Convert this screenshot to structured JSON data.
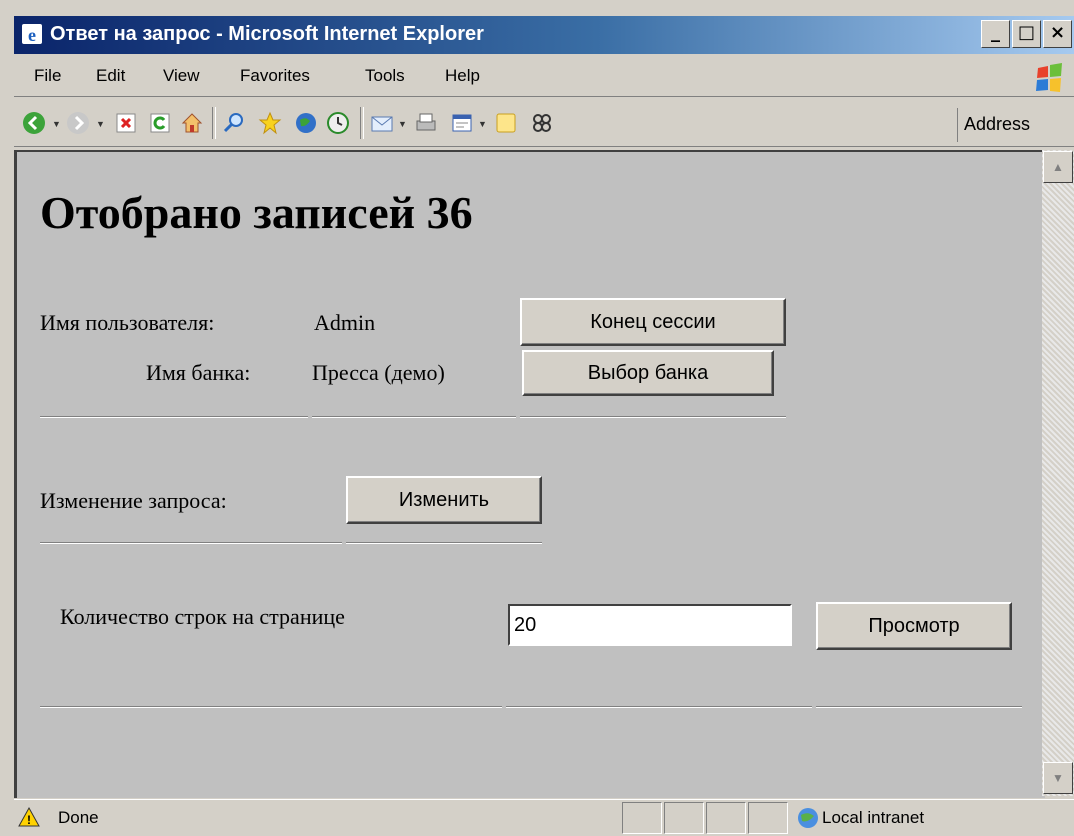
{
  "window": {
    "title": "Ответ на запрос - Microsoft Internet Explorer",
    "controls": [
      "_",
      "□",
      "×"
    ]
  },
  "menu": [
    "File",
    "Edit",
    "View",
    "Favorites",
    "Tools",
    "Help"
  ],
  "toolbar": {
    "icons": [
      "back-icon",
      "forward-icon",
      "stop-icon",
      "refresh-icon",
      "home-icon",
      "search-icon",
      "favorites-icon",
      "media-icon",
      "history-icon",
      "mail-icon",
      "print-icon",
      "edit-icon",
      "discuss-icon",
      "messenger-icon"
    ],
    "address_label": "Address"
  },
  "page": {
    "heading": "Отобрано записей 36",
    "user_label": "Имя пользователя:",
    "user_value": "Admin",
    "end_session_button": "Конец сессии",
    "bank_label": "Имя банка:",
    "bank_value": "Пресса (демо)",
    "choose_bank_button": "Выбор банка",
    "edit_query_label": "Изменение запроса:",
    "edit_button": "Изменить",
    "rows_label": "Количество строк на странице",
    "rows_value": "20",
    "view_button": "Просмотр"
  },
  "status": {
    "text": "Done",
    "zone": "Local intranet"
  },
  "colors": {
    "titlebar_start": "#0a246a",
    "titlebar_end": "#a6caf0",
    "content_bg": "#c0c0c0",
    "chrome_bg": "#d4d0c8"
  }
}
